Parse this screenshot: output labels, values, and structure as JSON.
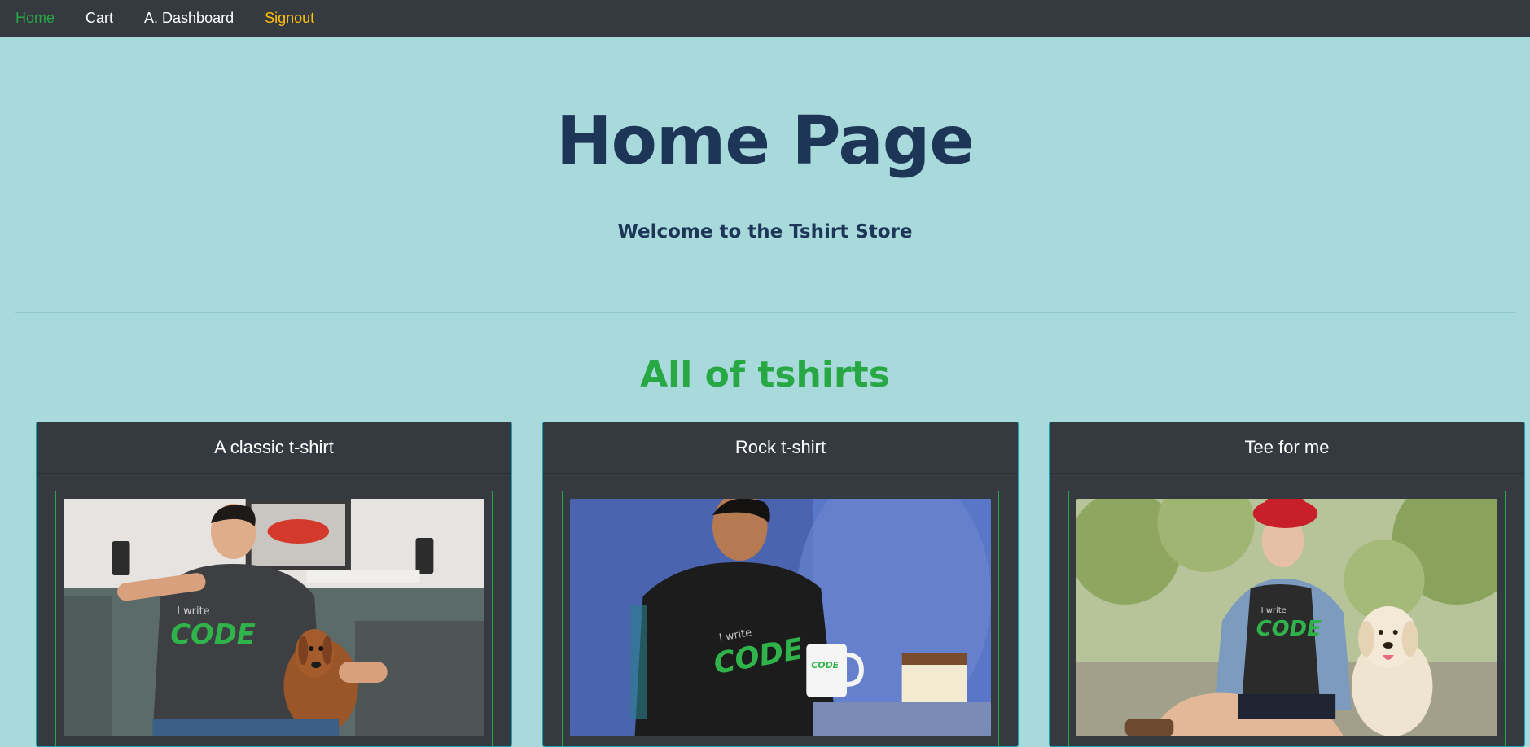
{
  "nav": {
    "items": [
      {
        "label": "Home",
        "state": "active"
      },
      {
        "label": "Cart",
        "state": "normal"
      },
      {
        "label": "A. Dashboard",
        "state": "normal"
      },
      {
        "label": "Signout",
        "state": "warning"
      }
    ]
  },
  "hero": {
    "title": "Home Page",
    "subtitle": "Welcome to the Tshirt Store"
  },
  "products": {
    "heading": "All of tshirts",
    "cards": [
      {
        "name": "A classic t-shirt",
        "shirt_text_small": "I write",
        "shirt_text_big": "CODE"
      },
      {
        "name": "Rock t-shirt",
        "shirt_text_small": "I write",
        "shirt_text_big": "CODE"
      },
      {
        "name": "Tee for me",
        "shirt_text_small": "I write",
        "shirt_text_big": "CODE"
      }
    ]
  },
  "colors": {
    "navbar": "#343a40",
    "background": "#a8dadc",
    "title": "#1d3557",
    "accent_green": "#28a745",
    "card_border": "#17a2b8",
    "signout": "#ffc107"
  }
}
